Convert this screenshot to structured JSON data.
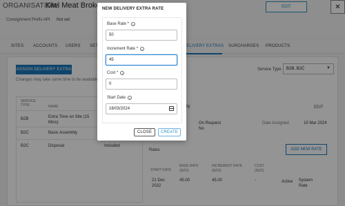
{
  "header": {
    "org_label": "ORGANISATION:",
    "org_name": "Kiwi Meat Brokers",
    "prefix_label": "Consignment Prefix API",
    "prefix_value": "Not set",
    "edit_label": "EDIT",
    "close_icon": "close-icon"
  },
  "tabs": [
    {
      "label": "SITES"
    },
    {
      "label": "ACCOUNTS"
    },
    {
      "label": "USERS"
    },
    {
      "label": "SET"
    },
    {
      "label": "DELIVERY EXTRAS",
      "active": true
    },
    {
      "label": "SURCHARGES"
    },
    {
      "label": "PRODUCTS"
    }
  ],
  "extras": {
    "assign_label": "ASSIGN DELIVERY EXTRA",
    "notice": "Changes may take some time to be available in",
    "service_type_label": "Service Type",
    "service_type_value": "B2B, B2C",
    "columns": [
      "SERVICE TYPE",
      "NAME"
    ],
    "rows": [
      {
        "service": "B2B",
        "name": "Extra Time on Site (15 Mins)"
      },
      {
        "service": "B2C",
        "name": "Basic Assembly"
      },
      {
        "service": "B2C",
        "name": "Disposal",
        "status": "Included"
      }
    ]
  },
  "detail": {
    "title_fragment": "ily",
    "edit_label": "EDIT",
    "on_request_label": "On Request",
    "on_request_value": "No",
    "date_assigned_label": "Date Assigned",
    "date_assigned_value": "15 Mar 2024",
    "rates_label": "Rates",
    "add_rate_label": "ADD NEW RATE",
    "rate_columns": [
      "START DATE",
      "BASE RATE (NZD)",
      "INCREMENT RATE (NZD)",
      "COST (NZD)"
    ],
    "rate_row": {
      "start": "21 Dec 2022",
      "base": "45.00",
      "increment": "45.00",
      "cost": "-",
      "status": "Active",
      "type": "System Rate"
    }
  },
  "modal": {
    "title": "NEW DELIVERY EXTRA RATE",
    "base_rate_label": "Base Rate *",
    "base_rate_value": "50",
    "increment_rate_label": "Increment Rate *",
    "increment_rate_value": "45",
    "cost_label": "Cost *",
    "cost_value": "0",
    "start_date_label": "Start Date",
    "start_date_value": "16/03/2024",
    "close_label": "CLOSE",
    "create_label": "CREATE"
  },
  "colors": {
    "accent": "#1a76b8",
    "overlay": "rgba(0,0,0,0.42)"
  }
}
